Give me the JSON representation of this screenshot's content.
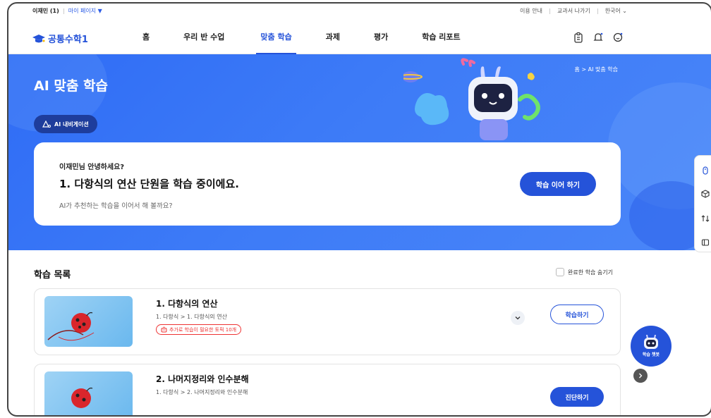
{
  "util": {
    "user": "이재민 (1)",
    "mypage": "마이 페이지 ▼",
    "links": [
      "이용 안내",
      "교과서 나가기",
      "한국어 ⌄"
    ]
  },
  "nav": {
    "brand": "공통수학1",
    "menu": [
      "홈",
      "우리 반 수업",
      "맞춤 학습",
      "과제",
      "평가",
      "학습 리포트"
    ],
    "active_index": 2,
    "icons": [
      "clipboard-icon",
      "bell-icon",
      "chat-icon"
    ]
  },
  "hero": {
    "title": "AI 맞춤 학습",
    "breadcrumb": "홈 > AI 맞춤 학습",
    "ai_nav_label": "AI 내비게이션",
    "card": {
      "greeting": "이재민님 안녕하세요?",
      "headline": "1. 다항식의 연산 단원을 학습 중이에요.",
      "sub": "AI가 추천하는 학습을 이어서 해 볼까요?",
      "cta": "학습 이어 하기"
    }
  },
  "list": {
    "title": "학습 목록",
    "hide_done_label": "완료한 학습 숨기기",
    "items": [
      {
        "title": "1. 다항식의 연산",
        "path": "1. 다항식 > 1. 다항식의 연산",
        "tag": "추가로 학습이 필요한 토픽 10개",
        "button": "학습하기",
        "button_style": "outline"
      },
      {
        "title": "2. 나머지정리와 인수분해",
        "path": "1. 다항식 > 2. 나머지정리와 인수분해",
        "button": "진단하기",
        "button_style": "filled"
      }
    ]
  },
  "chatbot": {
    "label": "학습 챗봇"
  },
  "colors": {
    "primary": "#2553d9",
    "hero": "#3d7bf7",
    "alert": "#e33333"
  }
}
